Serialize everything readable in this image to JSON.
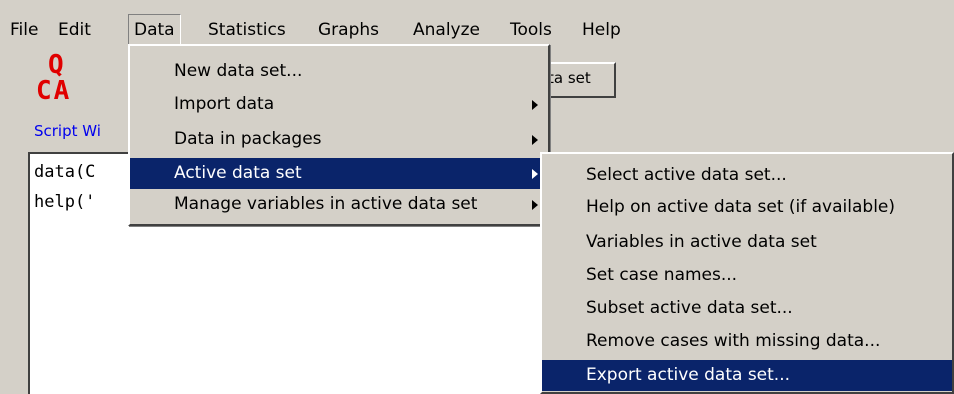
{
  "menubar": {
    "items": [
      "File",
      "Edit",
      "Data",
      "Statistics",
      "Graphs",
      "Analyze",
      "Tools",
      "Help"
    ],
    "open_item": "Data"
  },
  "logo": {
    "top": "Q",
    "bottom": "CA"
  },
  "script_label": "Script Wi",
  "toolbar_button_text": "ta set",
  "script_lines": [
    "data(C",
    "help('"
  ],
  "data_menu": [
    {
      "label": "New data set...",
      "submenu": false
    },
    {
      "label": "Import data",
      "submenu": true
    },
    {
      "label": "Data in packages",
      "submenu": true
    },
    {
      "label": "Active data set",
      "submenu": true,
      "highlighted": true
    },
    {
      "label": "Manage variables in active data set",
      "submenu": true
    }
  ],
  "active_data_set_menu": [
    {
      "label": "Select active data set..."
    },
    {
      "label": "Help on active data set (if available)"
    },
    {
      "label": "Variables in active data set"
    },
    {
      "label": "Set case names..."
    },
    {
      "label": "Subset active data set..."
    },
    {
      "label": "Remove cases with missing data..."
    },
    {
      "label": "Export active data set...",
      "highlighted": true
    }
  ],
  "colors": {
    "background": "#d4d0c8",
    "highlight": "#0a246a",
    "logo": "#e00000",
    "script_label": "#0000ee"
  }
}
